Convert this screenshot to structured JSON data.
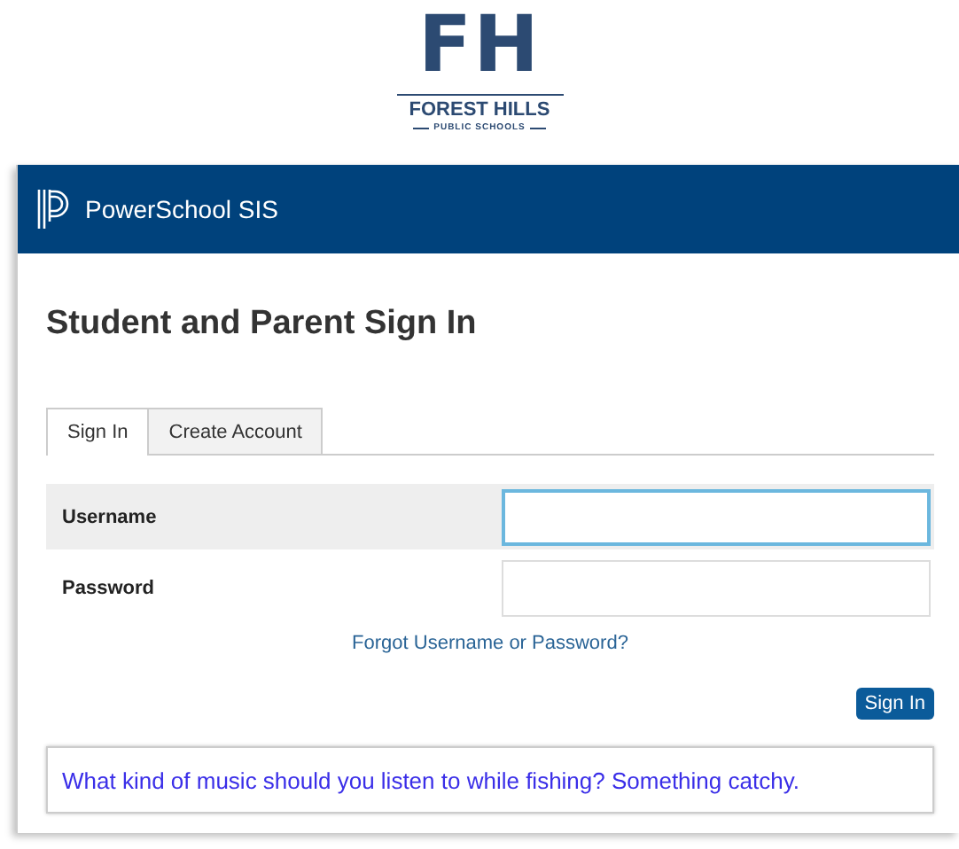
{
  "logo": {
    "initials": "FH",
    "name": "FOREST HILLS",
    "subtitle": "PUBLIC SCHOOLS"
  },
  "header": {
    "title": "PowerSchool SIS"
  },
  "page_title": "Student and Parent Sign In",
  "tabs": [
    {
      "label": "Sign In",
      "selected": true
    },
    {
      "label": "Create Account",
      "selected": false
    }
  ],
  "fields": [
    {
      "label": "Username",
      "focused": true,
      "highlighted": true
    },
    {
      "label": "Password",
      "focused": false,
      "highlighted": false
    }
  ],
  "forgot_link": "Forgot Username or Password?",
  "sign_in_button": "Sign In",
  "message": "What kind of music should you listen to while fishing? Something catchy."
}
